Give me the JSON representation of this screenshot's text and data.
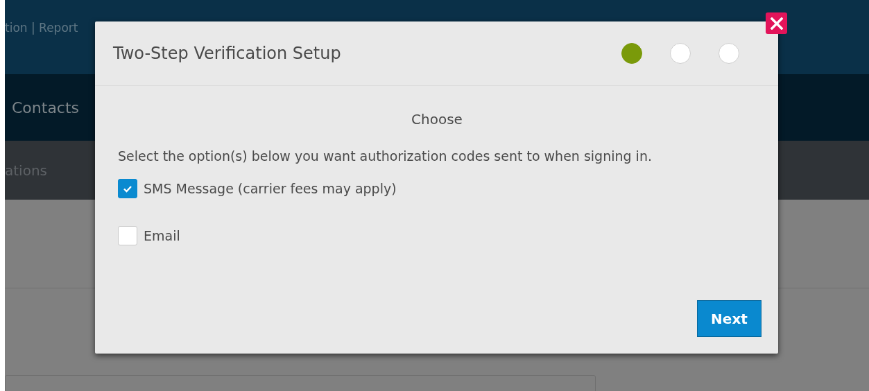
{
  "header": {
    "links_text": "tion | Report"
  },
  "nav": {
    "item": "Contacts"
  },
  "subnav": {
    "item": "ations"
  },
  "dialog": {
    "title": "Two-Step Verification Setup",
    "steps": [
      {
        "selected": true
      },
      {
        "selected": false
      },
      {
        "selected": false
      }
    ],
    "heading": "Choose",
    "instruction": "Select the option(s) below you want authorization codes sent to when signing in.",
    "options": [
      {
        "label": "SMS Message (carrier fees may apply)",
        "checked": true
      },
      {
        "label": "Email",
        "checked": false
      }
    ],
    "next_button": "Next"
  }
}
